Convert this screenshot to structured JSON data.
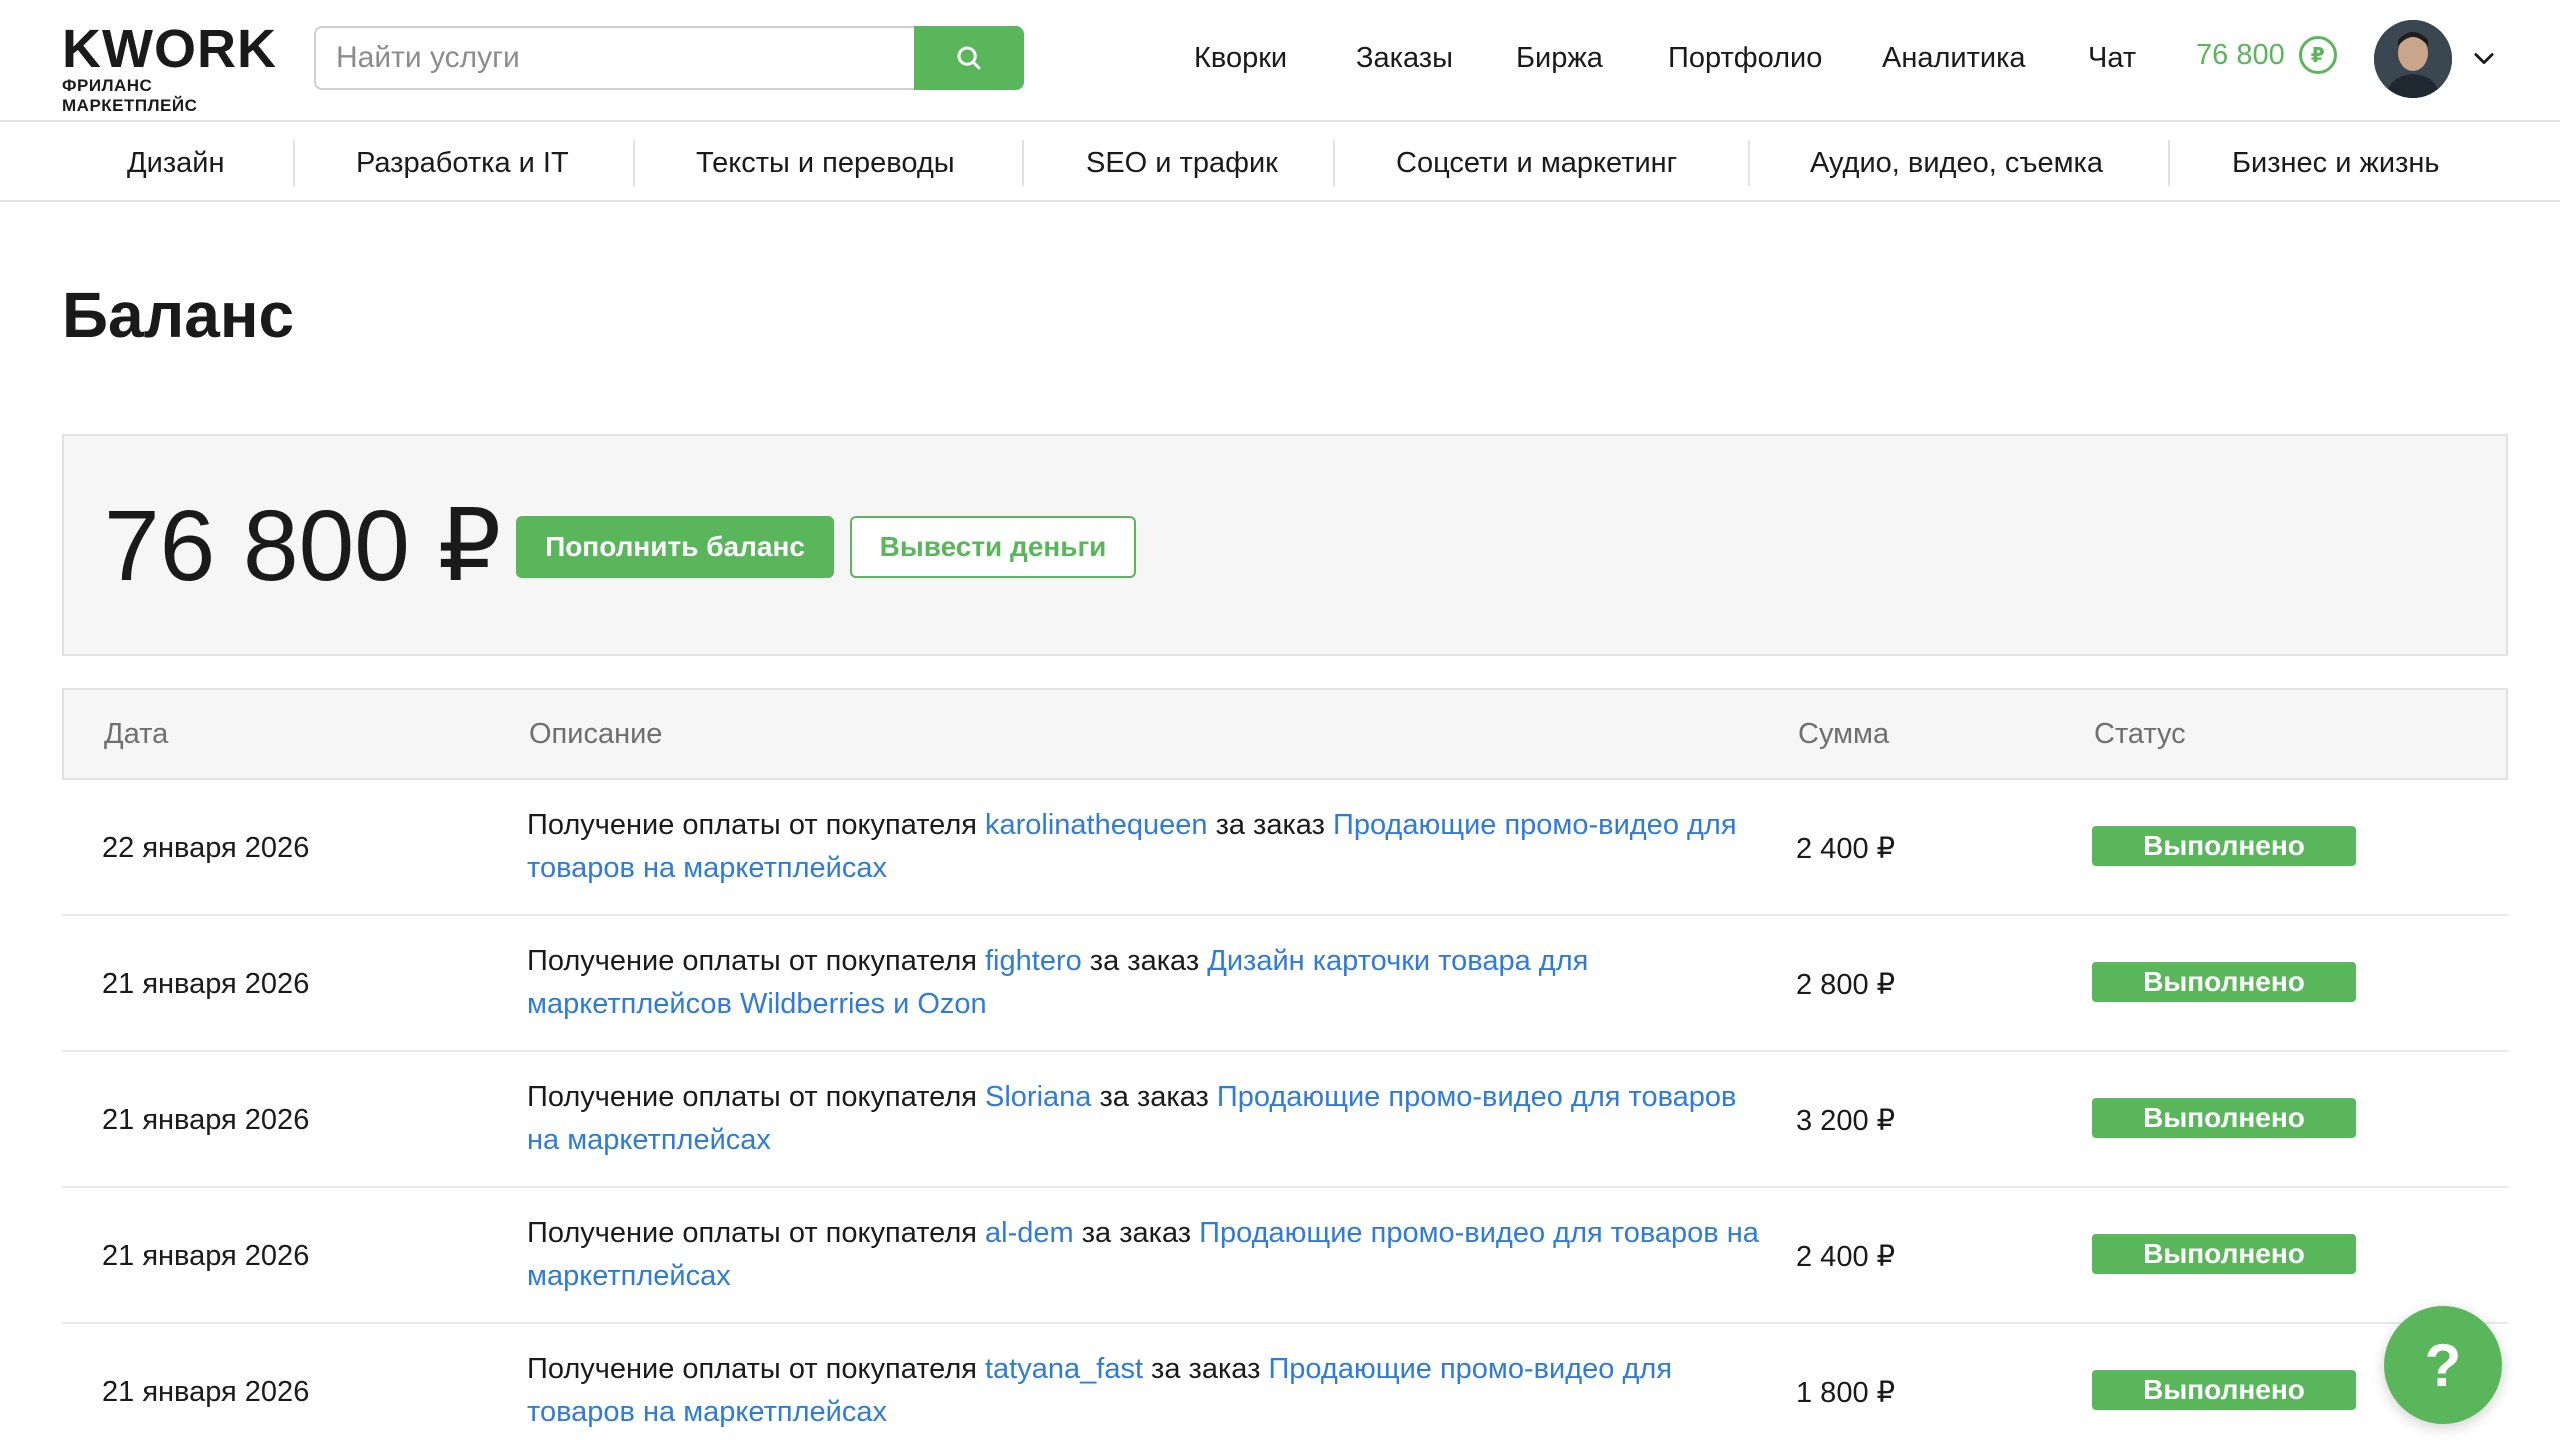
{
  "logo": {
    "main": "KWORK",
    "sub": "ФРИЛАНС МАРКЕТПЛЕЙС"
  },
  "search": {
    "placeholder": "Найти услуги",
    "icon": "search-icon"
  },
  "topnav": [
    "Кворки",
    "Заказы",
    "Биржа",
    "Портфолио",
    "Аналитика",
    "Чат"
  ],
  "header_balance": {
    "amount": "76 800",
    "currency_symbol": "₽"
  },
  "categories": [
    "Дизайн",
    "Разработка и IT",
    "Тексты и переводы",
    "SEO и трафик",
    "Соцсети и маркетинг",
    "Аудио, видео, съемка",
    "Бизнес и жизнь"
  ],
  "page": {
    "title": "Баланс"
  },
  "balance": {
    "amount": "76 800 ₽",
    "topup_label": "Пополнить баланс",
    "withdraw_label": "Вывести деньги"
  },
  "table": {
    "headers": {
      "date": "Дата",
      "description": "Описание",
      "sum": "Сумма",
      "status": "Статус"
    },
    "rows": [
      {
        "date": "22 января 2026",
        "prefix": "Получение оплаты от покупателя ",
        "buyer": "karolinathequeen",
        "mid": " за заказ ",
        "order": "Продающие промо-видео для товаров на маркетплейсах",
        "sum": "2 400 ₽",
        "status": "Выполнено"
      },
      {
        "date": "21 января 2026",
        "prefix": "Получение оплаты от покупателя ",
        "buyer": "fightero",
        "mid": " за заказ ",
        "order": "Дизайн карточки товара для маркетплейсов Wildberries и Ozon",
        "sum": "2 800 ₽",
        "status": "Выполнено"
      },
      {
        "date": "21 января 2026",
        "prefix": "Получение оплаты от покупателя ",
        "buyer": "Sloriana",
        "mid": " за заказ ",
        "order": "Продающие промо-видео для товаров на маркетплейсах",
        "sum": "3 200 ₽",
        "status": "Выполнено"
      },
      {
        "date": "21 января 2026",
        "prefix": "Получение оплаты от покупателя ",
        "buyer": "al-dem",
        "mid": " за заказ ",
        "order": "Продающие промо-видео для товаров на маркетплейсах",
        "sum": "2 400 ₽",
        "status": "Выполнено"
      },
      {
        "date": "21 января 2026",
        "prefix": "Получение оплаты от покупателя ",
        "buyer": "tatyana_fast",
        "mid": " за заказ ",
        "order": "Продающие промо-видео для товаров на маркетплейсах",
        "sum": "1 800 ₽",
        "status": "Выполнено"
      }
    ]
  },
  "help": {
    "label": "?"
  },
  "colors": {
    "accent": "#5ab65b",
    "link": "#2f7bd8",
    "logo_accent": "#f58220"
  }
}
